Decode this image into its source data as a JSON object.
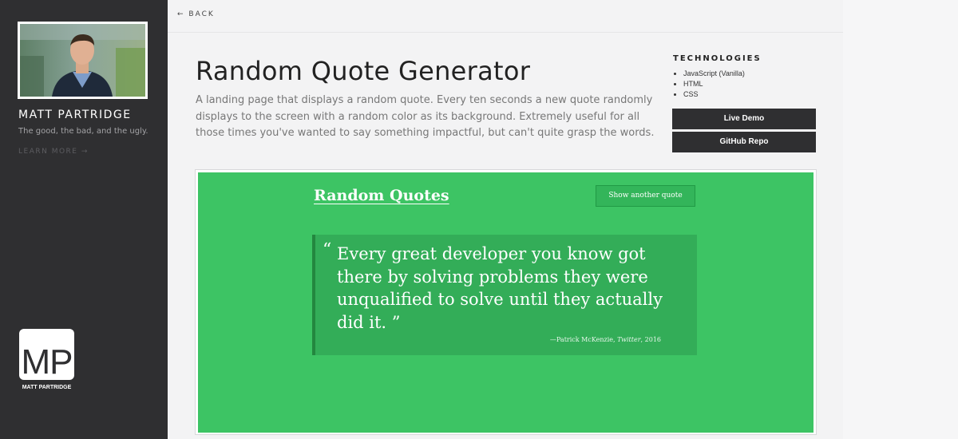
{
  "sidebar": {
    "name": "MATT PARTRIDGE",
    "tagline": "The good, the bad, and the ugly.",
    "learn_more": "LEARN MORE →",
    "logo_text": "MP",
    "logo_caption": "MATT PARTRIDGE"
  },
  "topbar": {
    "back": "← BACK"
  },
  "project": {
    "title": "Random Quote Generator",
    "description": "A landing page that displays a random quote. Every ten seconds a new quote randomly displays to the screen with a random color as its background. Extremely useful for all those times you've wanted to say something impactful, but can't quite grasp the words."
  },
  "technologies": {
    "heading": "TECHNOLOGIES",
    "items": [
      "JavaScript (Vanilla)",
      "HTML",
      "CSS"
    ]
  },
  "buttons": {
    "live_demo": "Live Demo",
    "github_repo": "GitHub Repo"
  },
  "preview": {
    "title": "Random Quotes",
    "button": "Show another quote",
    "open_quote": "“",
    "quote": "Every great developer you know got there by solving problems they were unqualified to solve until they actually did it.",
    "close_quote": "”",
    "attribution_prefix": "—Patrick McKenzie, ",
    "attribution_source": "Twitter",
    "attribution_year": ", 2016",
    "background_color": "#3dc464"
  },
  "colors": {
    "sidebar": "#2f2f31",
    "page": "#f3f3f4",
    "accent_button": "#2f2f31",
    "preview_green": "#3dc464"
  }
}
